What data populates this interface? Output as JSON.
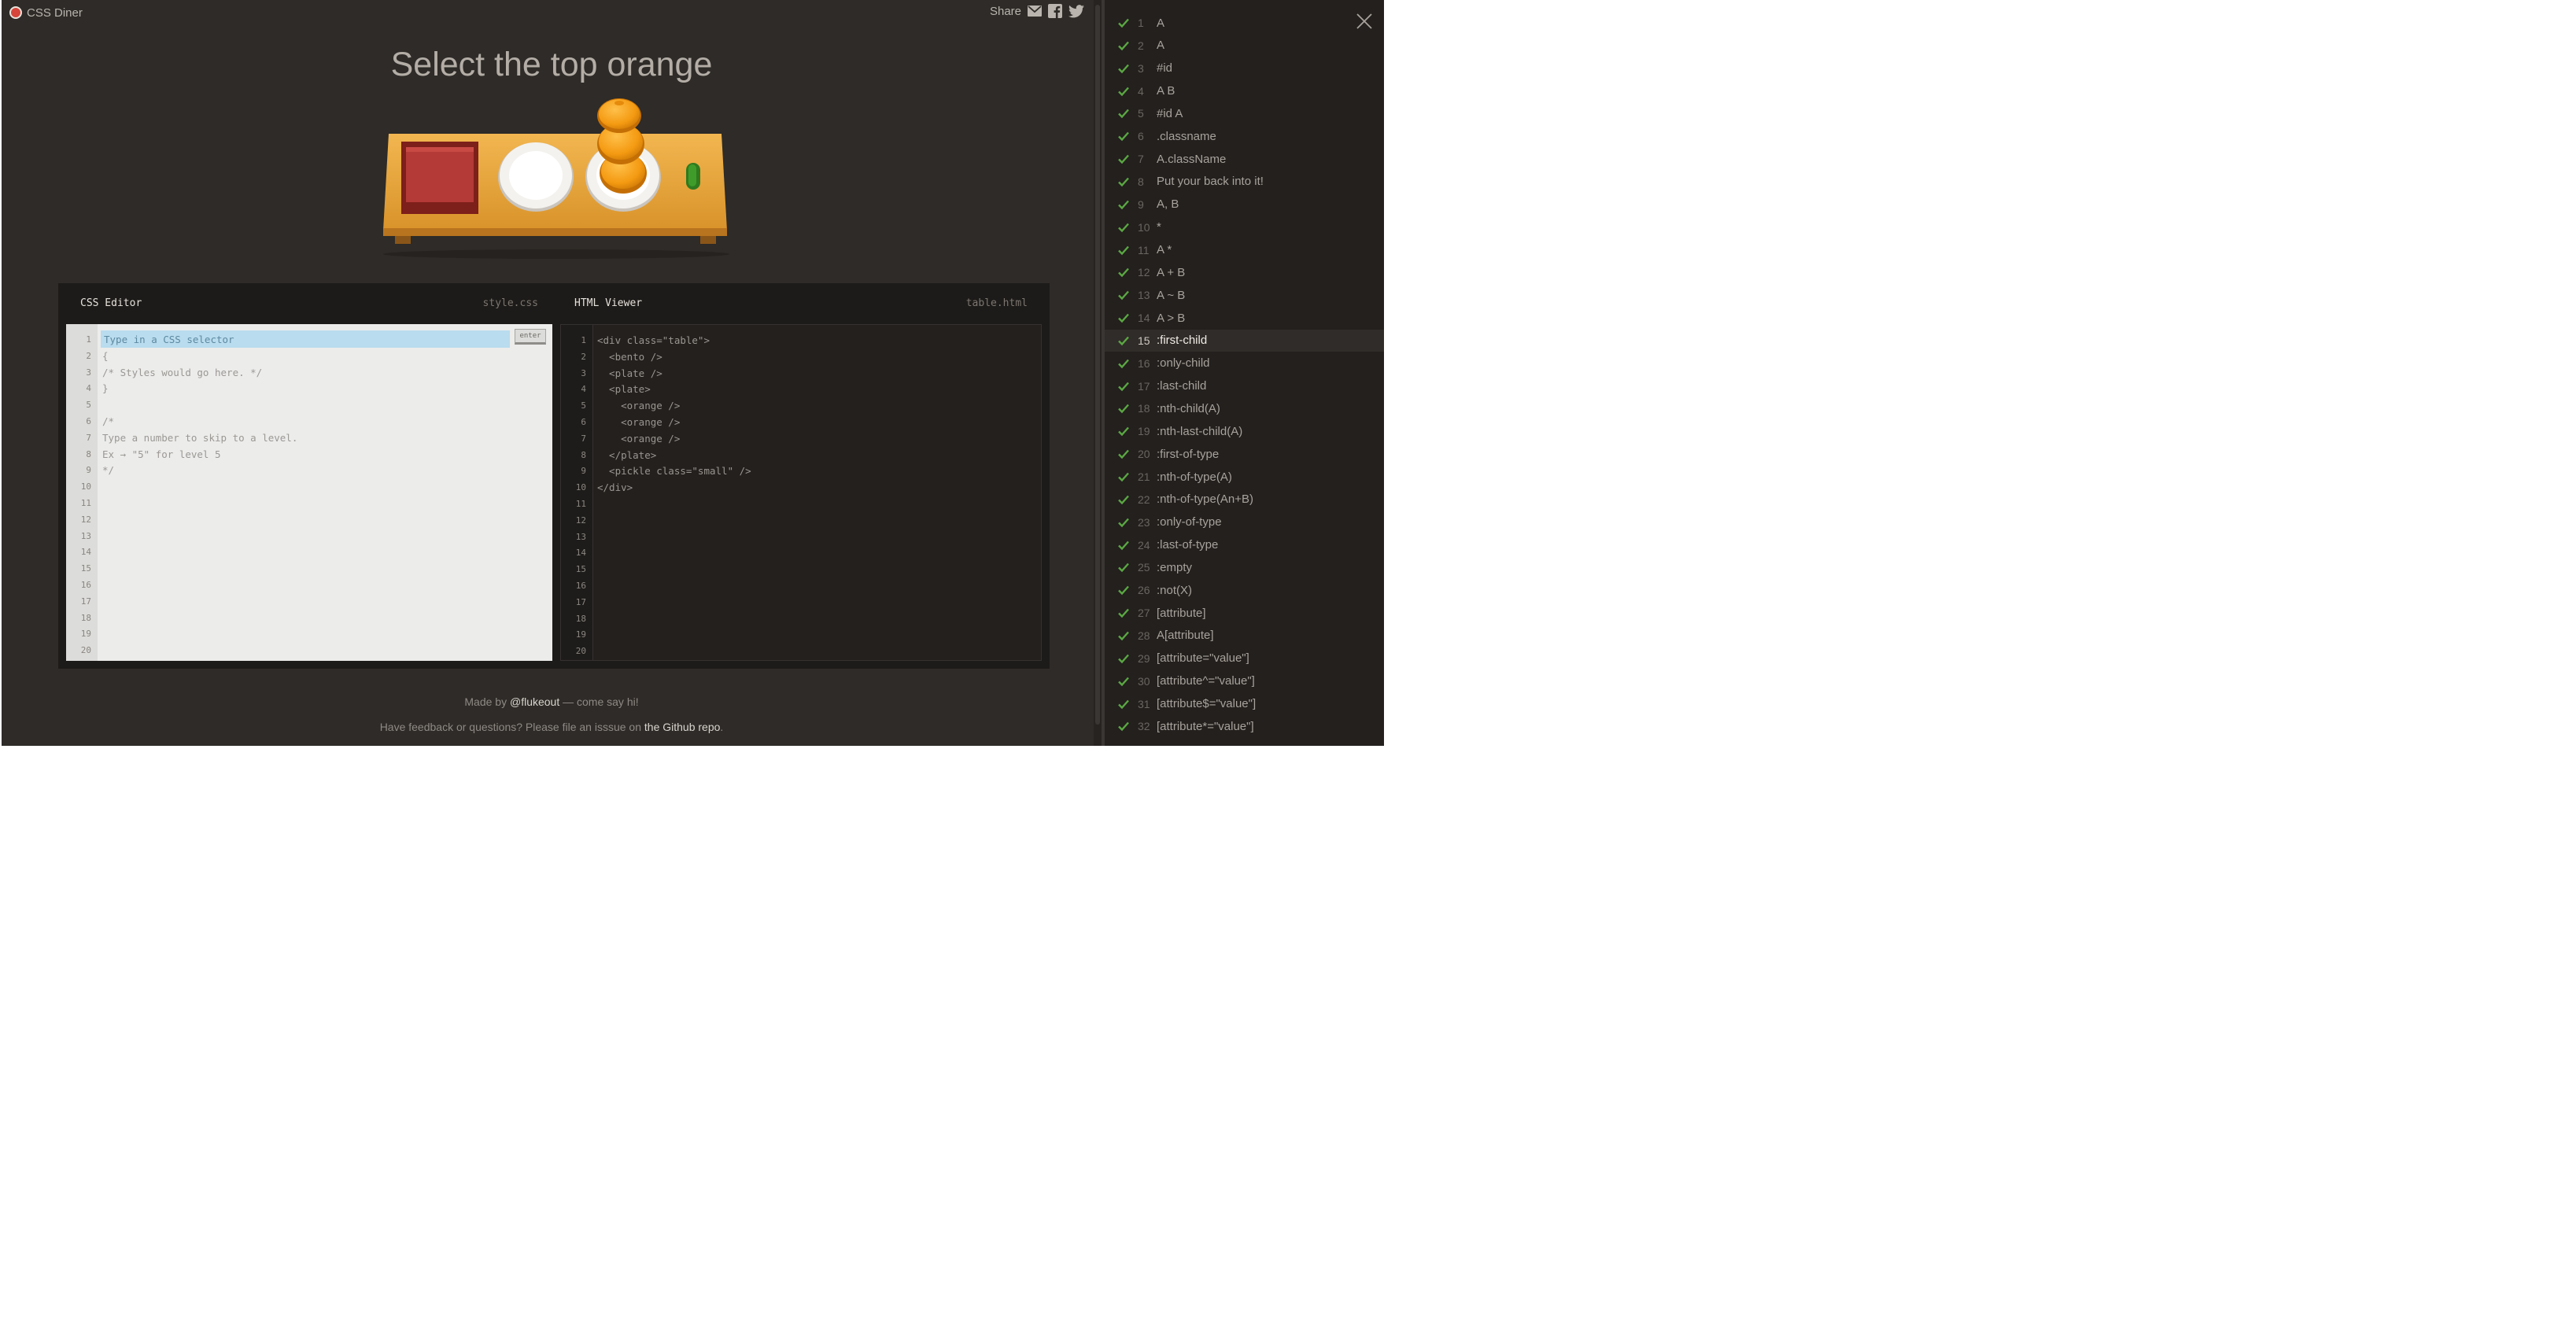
{
  "brand": {
    "name": "CSS Diner"
  },
  "share": {
    "label": "Share",
    "icons": [
      "email-icon",
      "facebook-icon",
      "twitter-icon"
    ]
  },
  "title": "Select the top orange",
  "colors": {
    "background": "#2e2b28",
    "accent": "#5ba743",
    "highlight": "#b9dcee"
  },
  "editor": {
    "css_label": "CSS Editor",
    "css_file": "style.css",
    "html_label": "HTML Viewer",
    "html_file": "table.html",
    "input_placeholder": "Type in a CSS selector",
    "enter_label": "enter",
    "css_lines": [
      "",
      "{",
      "/* Styles would go here. */",
      "}",
      "",
      "/*",
      "Type a number to skip to a level.",
      "Ex → \"5\" for level 5",
      "*/"
    ],
    "html_lines": [
      "<div class=\"table\">",
      "  <bento />",
      "  <plate />",
      "  <plate>",
      "    <orange />",
      "    <orange />",
      "    <orange />",
      "  </plate>",
      "  <pickle class=\"small\" />",
      "</div>"
    ],
    "line_numbers": [
      "1",
      "2",
      "3",
      "4",
      "5",
      "6",
      "7",
      "8",
      "9",
      "10",
      "11",
      "12",
      "13",
      "14",
      "15",
      "16",
      "17",
      "18",
      "19",
      "20"
    ]
  },
  "footer": {
    "made_prefix": "Made by ",
    "made_link": "@flukeout",
    "made_suffix": " — come say hi!",
    "feedback_prefix": "Have feedback or questions? Please file an isssue on ",
    "feedback_link": "the Github repo",
    "feedback_suffix": "."
  },
  "levels": {
    "current": 15,
    "items": [
      {
        "num": "1",
        "selector": "A",
        "done": true
      },
      {
        "num": "2",
        "selector": "A",
        "done": true
      },
      {
        "num": "3",
        "selector": "#id",
        "done": true
      },
      {
        "num": "4",
        "selector": "A  B",
        "done": true
      },
      {
        "num": "5",
        "selector": "#id  A",
        "done": true
      },
      {
        "num": "6",
        "selector": ".classname",
        "done": true
      },
      {
        "num": "7",
        "selector": "A.className",
        "done": true
      },
      {
        "num": "8",
        "selector": "Put your back into it!",
        "done": true
      },
      {
        "num": "9",
        "selector": "A, B",
        "done": true
      },
      {
        "num": "10",
        "selector": "*",
        "done": true
      },
      {
        "num": "11",
        "selector": "A  *",
        "done": true
      },
      {
        "num": "12",
        "selector": "A + B",
        "done": true
      },
      {
        "num": "13",
        "selector": "A ~ B",
        "done": true
      },
      {
        "num": "14",
        "selector": "A > B",
        "done": true
      },
      {
        "num": "15",
        "selector": ":first-child",
        "done": true
      },
      {
        "num": "16",
        "selector": ":only-child",
        "done": true
      },
      {
        "num": "17",
        "selector": ":last-child",
        "done": true
      },
      {
        "num": "18",
        "selector": ":nth-child(A)",
        "done": true
      },
      {
        "num": "19",
        "selector": ":nth-last-child(A)",
        "done": true
      },
      {
        "num": "20",
        "selector": ":first-of-type",
        "done": true
      },
      {
        "num": "21",
        "selector": ":nth-of-type(A)",
        "done": true
      },
      {
        "num": "22",
        "selector": ":nth-of-type(An+B)",
        "done": true
      },
      {
        "num": "23",
        "selector": ":only-of-type",
        "done": true
      },
      {
        "num": "24",
        "selector": ":last-of-type",
        "done": true
      },
      {
        "num": "25",
        "selector": ":empty",
        "done": true
      },
      {
        "num": "26",
        "selector": ":not(X)",
        "done": true
      },
      {
        "num": "27",
        "selector": "[attribute]",
        "done": true
      },
      {
        "num": "28",
        "selector": "A[attribute]",
        "done": true
      },
      {
        "num": "29",
        "selector": "[attribute=\"value\"]",
        "done": true
      },
      {
        "num": "30",
        "selector": "[attribute^=\"value\"]",
        "done": true
      },
      {
        "num": "31",
        "selector": "[attribute$=\"value\"]",
        "done": true
      },
      {
        "num": "32",
        "selector": "[attribute*=\"value\"]",
        "done": true
      }
    ]
  }
}
